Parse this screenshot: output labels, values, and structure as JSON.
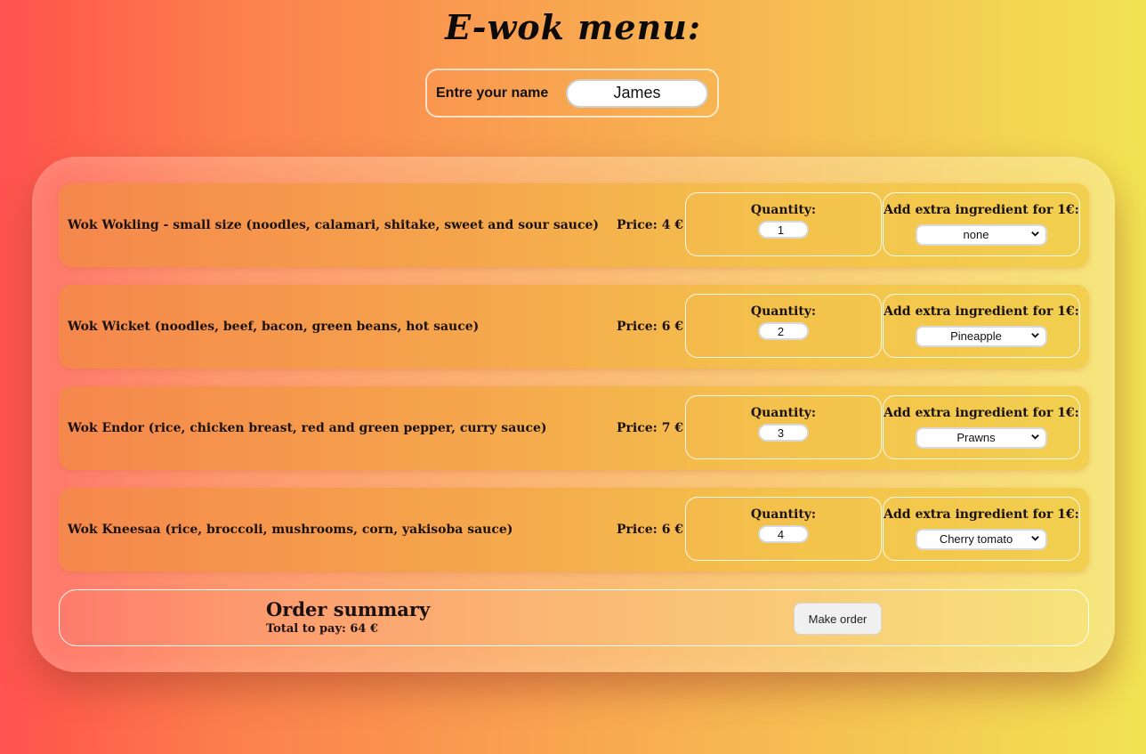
{
  "page": {
    "title": "E-wok menu:"
  },
  "name_form": {
    "label": "Entre your name",
    "value": "James"
  },
  "menu": {
    "price_prefix": "Price:",
    "items": [
      {
        "description": "Wok Wokling - small size (noodles, calamari, shitake, sweet and sour sauce)",
        "price": "Price: 4 €",
        "quantity_label": "Quantity:",
        "quantity": "1",
        "extra_label": "Add extra ingredient for 1€:",
        "extra_selected": "none"
      },
      {
        "description": "Wok Wicket (noodles, beef, bacon, green beans, hot sauce)",
        "price": "Price: 6 €",
        "quantity_label": "Quantity:",
        "quantity": "2",
        "extra_label": "Add extra ingredient for 1€:",
        "extra_selected": "Pineapple"
      },
      {
        "description": "Wok Endor (rice, chicken breast, red and green pepper, curry sauce)",
        "price": "Price: 7 €",
        "quantity_label": "Quantity:",
        "quantity": "3",
        "extra_label": "Add extra ingredient for 1€:",
        "extra_selected": "Prawns"
      },
      {
        "description": "Wok Kneesaa (rice, broccoli, mushrooms, corn, yakisoba sauce)",
        "price": "Price: 6 €",
        "quantity_label": "Quantity:",
        "quantity": "4",
        "extra_label": "Add extra ingredient for 1€:",
        "extra_selected": "Cherry tomato"
      }
    ]
  },
  "summary": {
    "title": "Order summary",
    "total": "Total to pay: 64 €",
    "order_button": "Make order"
  },
  "icons": {
    "select_arrow": "chevron-down-icon"
  },
  "colors": {
    "background_left": "#fe5350",
    "background_right": "#f2e352",
    "row_left": "#f5874c",
    "row_right": "#f2cf4e"
  }
}
